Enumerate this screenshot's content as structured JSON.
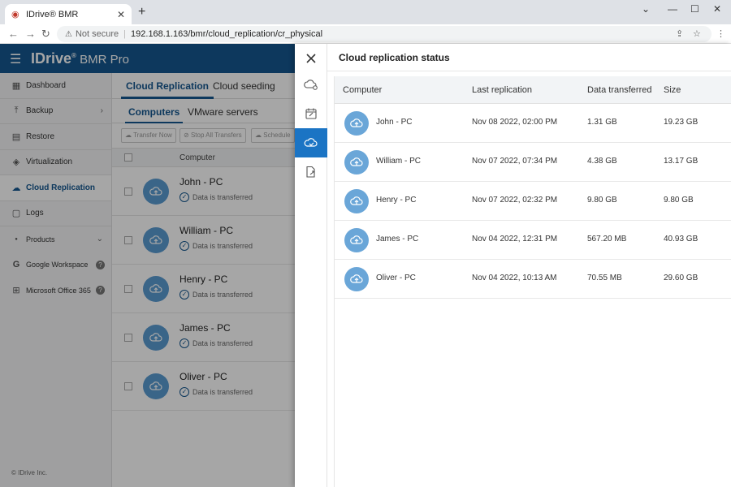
{
  "browser": {
    "tab_title": "IDrive® BMR",
    "not_secure": "Not secure",
    "url": "192.168.1.163/bmr/cloud_replication/cr_physical"
  },
  "app": {
    "logo_main": "IDrive",
    "logo_reg": "®",
    "logo_bmr": " BMR",
    "logo_pro": " Pro",
    "copyright": "© IDrive Inc."
  },
  "sidebar": {
    "items": [
      {
        "label": "Dashboard",
        "icon": "dashboard-icon"
      },
      {
        "label": "Backup",
        "icon": "backup-icon"
      },
      {
        "label": "Restore",
        "icon": "restore-icon"
      },
      {
        "label": "Virtualization",
        "icon": "layers-icon"
      },
      {
        "label": "Cloud Replication",
        "icon": "cloud-icon"
      },
      {
        "label": "Logs",
        "icon": "logs-icon"
      },
      {
        "label": "Products",
        "icon": "dot-icon"
      },
      {
        "label": "Google Workspace",
        "icon": "google-icon"
      },
      {
        "label": "Microsoft Office 365",
        "icon": "windows-icon"
      }
    ]
  },
  "main": {
    "tabs": [
      "Cloud Replication",
      "Cloud seeding"
    ],
    "subtabs": [
      "Computers",
      "VMware servers"
    ],
    "actions": [
      "Transfer Now",
      "Stop All Transfers",
      "Schedule"
    ],
    "column_computer": "Computer",
    "status_text": "Data is transferred",
    "rows": [
      "John - PC",
      "William - PC",
      "Henry - PC",
      "James - PC",
      "Oliver - PC"
    ]
  },
  "drawer": {
    "title": "Cloud replication status",
    "columns": [
      "Computer",
      "Last replication",
      "Data transferred",
      "Size"
    ],
    "rows": [
      {
        "computer": "John - PC",
        "last": "Nov 08 2022, 02:00 PM",
        "transferred": "1.31 GB",
        "size": "19.23 GB"
      },
      {
        "computer": "William - PC",
        "last": "Nov 07 2022, 07:34 PM",
        "transferred": "4.38 GB",
        "size": "13.17 GB"
      },
      {
        "computer": "Henry - PC",
        "last": "Nov 07 2022, 02:32 PM",
        "transferred": "9.80 GB",
        "size": "9.80 GB"
      },
      {
        "computer": "James - PC",
        "last": "Nov 04 2022, 12:31 PM",
        "transferred": "567.20 MB",
        "size": "40.93 GB"
      },
      {
        "computer": "Oliver - PC",
        "last": "Nov 04 2022, 10:13 AM",
        "transferred": "70.55 MB",
        "size": "29.60 GB"
      }
    ]
  },
  "colors": {
    "brand": "#14578f",
    "accent": "#1b74c4",
    "avatar": "#5a9bd2"
  }
}
